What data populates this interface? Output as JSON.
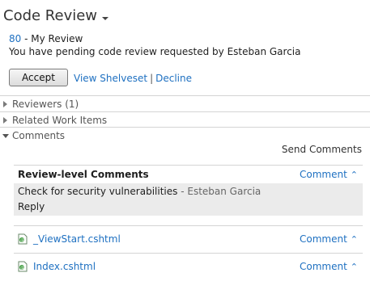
{
  "header": {
    "title": "Code Review"
  },
  "request": {
    "id": "80",
    "name": "- My Review",
    "message": "You have pending code review requested by Esteban Garcia"
  },
  "actions": {
    "accept": "Accept",
    "view_shelveset": "View Shelveset",
    "separator": "|",
    "decline": "Decline"
  },
  "sections": {
    "reviewers": "Reviewers (1)",
    "related_work_items": "Related Work Items",
    "comments": "Comments"
  },
  "comments": {
    "send_label": "Send Comments",
    "review_level": {
      "title": "Review-level Comments",
      "comment_label": "Comment",
      "text": "Check for security vulnerabilities",
      "author": "- Esteban Garcia",
      "reply": "Reply"
    },
    "files": [
      {
        "name": "_ViewStart.cshtml",
        "comment_label": "Comment"
      },
      {
        "name": "Index.cshtml",
        "comment_label": "Comment"
      }
    ]
  },
  "colors": {
    "link": "#1e70c1",
    "panel": "#ebebeb",
    "divider": "#d4d4d4"
  }
}
